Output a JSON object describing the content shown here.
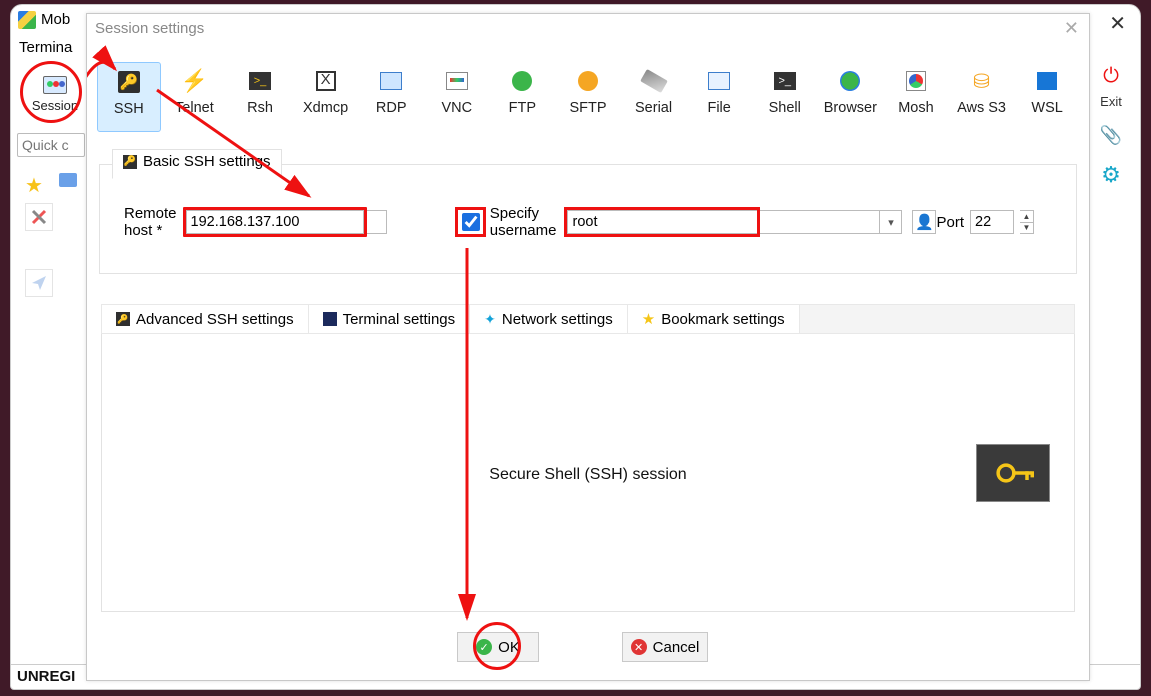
{
  "main_window": {
    "title_fragment": "Mob",
    "menu_fragment": "Termina",
    "quick_placeholder": "Quick c",
    "footer": "UNREGI"
  },
  "right_toolbar": {
    "exit_label": "Exit"
  },
  "session_button": {
    "label": "Session"
  },
  "dialog": {
    "title": "Session settings",
    "session_types": [
      {
        "id": "ssh",
        "label": "SSH",
        "selected": true
      },
      {
        "id": "telnet",
        "label": "Telnet"
      },
      {
        "id": "rsh",
        "label": "Rsh"
      },
      {
        "id": "xdmcp",
        "label": "Xdmcp"
      },
      {
        "id": "rdp",
        "label": "RDP"
      },
      {
        "id": "vnc",
        "label": "VNC"
      },
      {
        "id": "ftp",
        "label": "FTP"
      },
      {
        "id": "sftp",
        "label": "SFTP"
      },
      {
        "id": "serial",
        "label": "Serial"
      },
      {
        "id": "file",
        "label": "File"
      },
      {
        "id": "shell",
        "label": "Shell"
      },
      {
        "id": "browser",
        "label": "Browser"
      },
      {
        "id": "mosh",
        "label": "Mosh"
      },
      {
        "id": "aws",
        "label": "Aws S3"
      },
      {
        "id": "wsl",
        "label": "WSL"
      }
    ],
    "basic_group_title": "Basic SSH settings",
    "remote_host_label": "Remote host *",
    "remote_host_value": "192.168.137.100",
    "specify_username_label": "Specify username",
    "specify_username_checked": true,
    "username_value": "root",
    "port_label": "Port",
    "port_value": "22",
    "tabs": [
      {
        "id": "adv",
        "label": "Advanced SSH settings"
      },
      {
        "id": "term",
        "label": "Terminal settings"
      },
      {
        "id": "net",
        "label": "Network settings"
      },
      {
        "id": "book",
        "label": "Bookmark settings"
      }
    ],
    "session_description": "Secure Shell (SSH) session",
    "ok_label": "OK",
    "cancel_label": "Cancel"
  }
}
